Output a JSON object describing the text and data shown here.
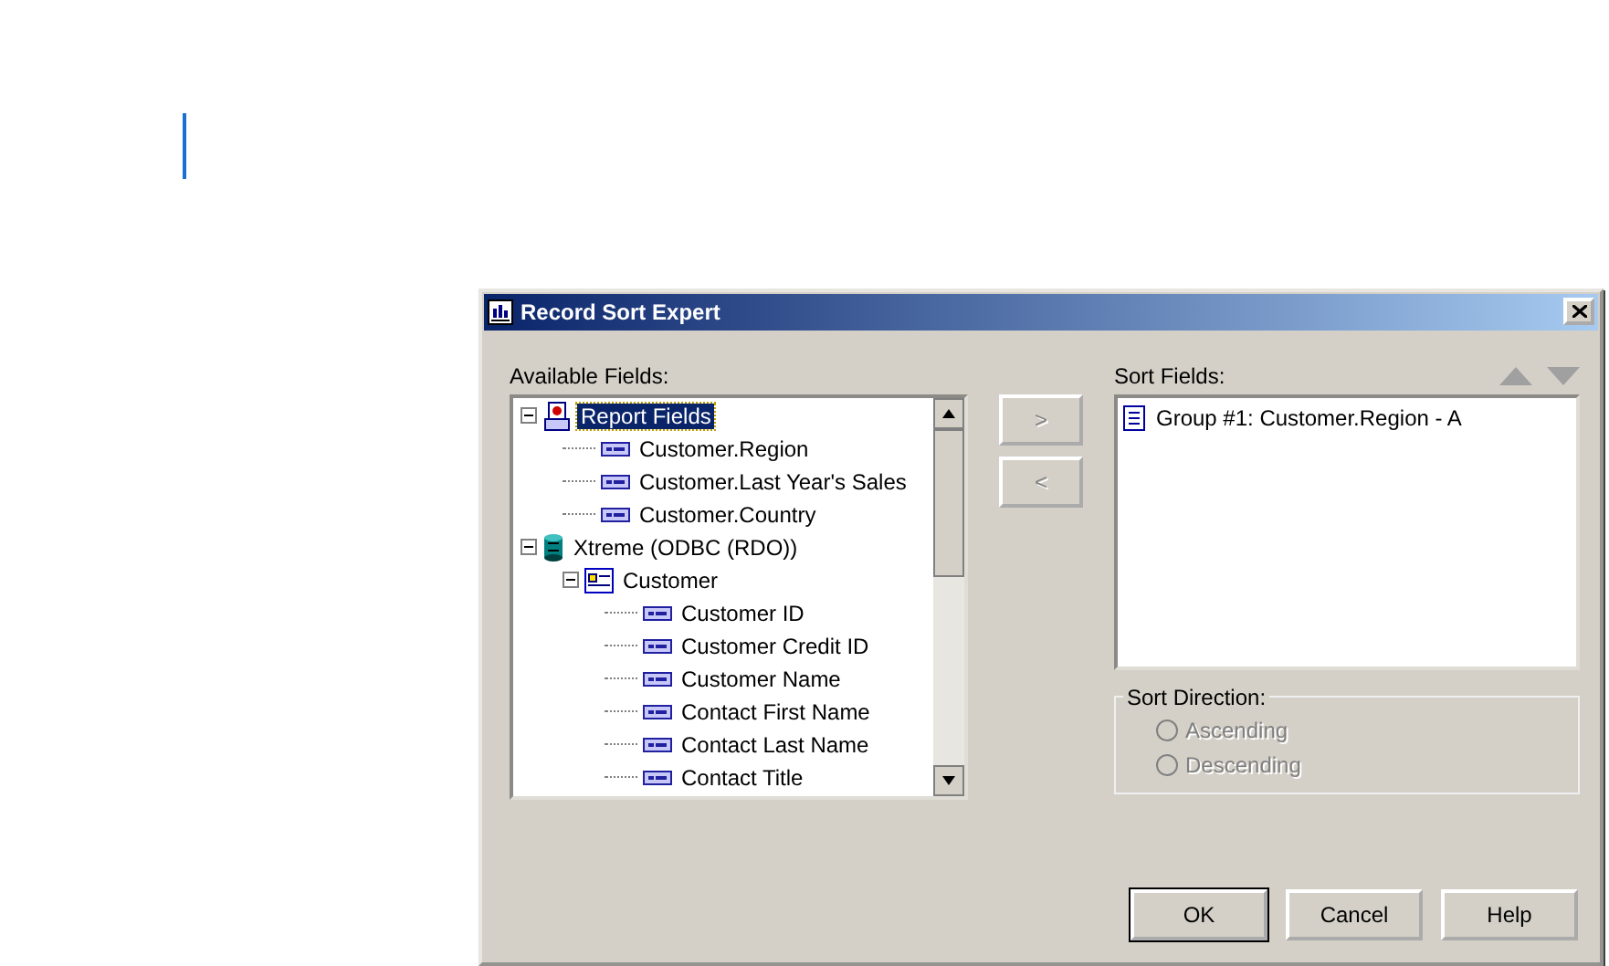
{
  "dialog": {
    "title": "Record Sort Expert",
    "available_fields": {
      "label": "Available Fields:",
      "tree": [
        {
          "kind": "report",
          "label": "Report Fields",
          "selected": true,
          "expanded": true,
          "children": [
            {
              "kind": "field",
              "label": "Customer.Region",
              "selected": false
            },
            {
              "kind": "field",
              "label": "Customer.Last Year's Sales",
              "selected": false
            },
            {
              "kind": "field",
              "label": "Customer.Country",
              "selected": false
            }
          ]
        },
        {
          "kind": "database",
          "label": "Xtreme (ODBC (RDO))",
          "selected": false,
          "expanded": true,
          "children": [
            {
              "kind": "table",
              "label": "Customer",
              "selected": false,
              "expanded": true,
              "children": [
                {
                  "kind": "field",
                  "label": "Customer ID",
                  "selected": false
                },
                {
                  "kind": "field",
                  "label": "Customer Credit ID",
                  "selected": false
                },
                {
                  "kind": "field",
                  "label": "Customer Name",
                  "selected": false
                },
                {
                  "kind": "field",
                  "label": "Contact First Name",
                  "selected": false
                },
                {
                  "kind": "field",
                  "label": "Contact Last Name",
                  "selected": false
                },
                {
                  "kind": "field",
                  "label": "Contact Title",
                  "selected": false
                }
              ]
            }
          ]
        }
      ]
    },
    "move_buttons": [
      {
        "label": ">",
        "disabled": true
      },
      {
        "label": "<",
        "disabled": true
      }
    ],
    "sort_fields": {
      "label": "Sort Fields:",
      "items": [
        {
          "label": "Group #1: Customer.Region - A",
          "selected": false
        }
      ]
    },
    "sort_direction": {
      "label": "Sort Direction:",
      "options": [
        {
          "label": "Ascending",
          "selected": false,
          "disabled": true
        },
        {
          "label": "Descending",
          "selected": false,
          "disabled": true
        }
      ]
    },
    "buttons": [
      {
        "label": "OK",
        "default": true
      },
      {
        "label": "Cancel",
        "default": false
      },
      {
        "label": "Help",
        "default": false
      }
    ]
  }
}
